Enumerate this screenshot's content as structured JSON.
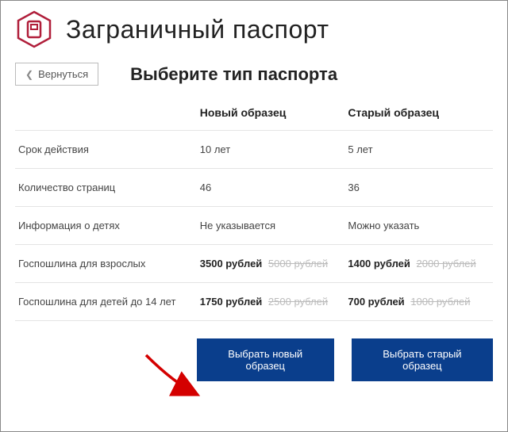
{
  "header": {
    "title": "Заграничный паспорт",
    "back_label": "Вернуться",
    "subtitle": "Выберите тип паспорта"
  },
  "columns": {
    "new": "Новый образец",
    "old": "Старый образец"
  },
  "rows": [
    {
      "label": "Срок действия",
      "new": "10 лет",
      "old": "5 лет"
    },
    {
      "label": "Количество страниц",
      "new": "46",
      "old": "36"
    },
    {
      "label": "Информация о детях",
      "new": "Не указывается",
      "old": "Можно указать"
    },
    {
      "label": "Госпошлина для взрослых",
      "new_price": "3500 рублей",
      "new_old": "5000 рублей",
      "old_price": "1400 рублей",
      "old_old": "2000 рублей"
    },
    {
      "label": "Госпошлина для детей до 14 лет",
      "new_price": "1750 рублей",
      "new_old": "2500 рублей",
      "old_price": "700 рублей",
      "old_old": "1000 рублей"
    }
  ],
  "actions": {
    "choose_new": "Выбрать новый образец",
    "choose_old": "Выбрать старый образец"
  }
}
